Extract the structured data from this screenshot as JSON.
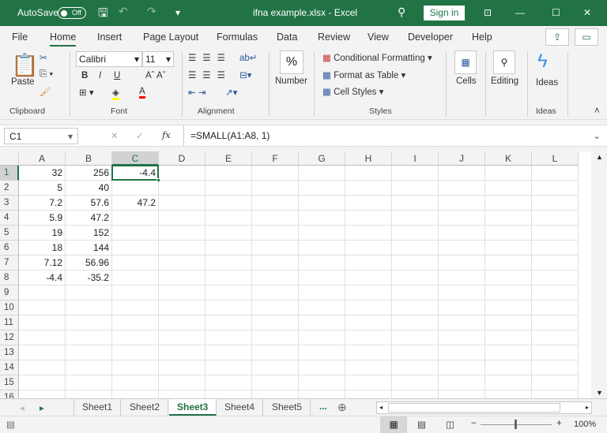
{
  "title": {
    "autosave": "AutoSave",
    "toggle": "Off",
    "doc": "ifna example.xlsx  -  Excel",
    "signin": "Sign in"
  },
  "tabs": [
    "File",
    "Home",
    "Insert",
    "Page Layout",
    "Formulas",
    "Data",
    "Review",
    "View",
    "Developer",
    "Help"
  ],
  "ribbon": {
    "paste": "Paste",
    "font_name": "Calibri",
    "font_size": "11",
    "bold": "B",
    "italic": "I",
    "underline": "U",
    "number": "Number",
    "percent": "%",
    "cond": "Conditional Formatting",
    "fmt_table": "Format as Table",
    "cell_styles": "Cell Styles",
    "cells": "Cells",
    "editing": "Editing",
    "ideas": "Ideas",
    "groups": {
      "clipboard": "Clipboard",
      "font": "Font",
      "alignment": "Alignment",
      "styles": "Styles",
      "ideas": "Ideas"
    }
  },
  "formula_bar": {
    "name_box": "C1",
    "fx": "fx",
    "formula": "=SMALL(A1:A8, 1)"
  },
  "columns": [
    "A",
    "B",
    "C",
    "D",
    "E",
    "F",
    "G",
    "H",
    "I",
    "J",
    "K",
    "L"
  ],
  "row_numbers": [
    "1",
    "2",
    "3",
    "4",
    "5",
    "6",
    "7",
    "8",
    "9",
    "10",
    "11",
    "12",
    "13",
    "14",
    "15",
    "16"
  ],
  "rows": [
    [
      "32",
      "256",
      "-4.4"
    ],
    [
      "5",
      "40",
      ""
    ],
    [
      "7.2",
      "57.6",
      "47.2"
    ],
    [
      "5.9",
      "47.2",
      ""
    ],
    [
      "19",
      "152",
      ""
    ],
    [
      "18",
      "144",
      ""
    ],
    [
      "7.12",
      "56.96",
      ""
    ],
    [
      "-4.4",
      "-35.2",
      ""
    ]
  ],
  "selected_cell": "C1",
  "sheets": {
    "tabs": [
      "Sheet1",
      "Sheet2",
      "Sheet3",
      "Sheet4",
      "Sheet5"
    ],
    "active": "Sheet3",
    "more": "..."
  },
  "status": {
    "zoom": "100%"
  },
  "colors": {
    "accent": "#217346"
  }
}
